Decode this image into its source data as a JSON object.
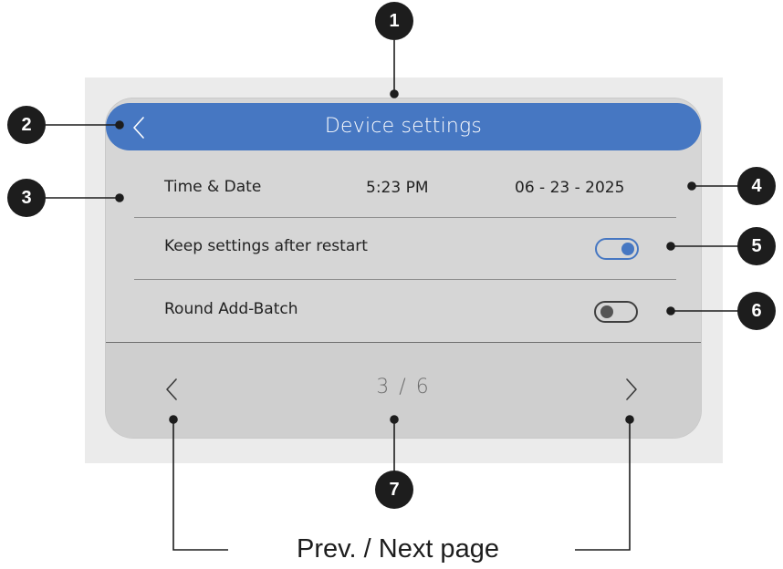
{
  "screen": {
    "title": "Device settings",
    "rows": {
      "time_date": {
        "label": "Time & Date",
        "time": "5:23 PM",
        "date": "06 - 23 - 2025"
      },
      "keep_settings": {
        "label": "Keep settings after restart",
        "enabled": true
      },
      "round_add_batch": {
        "label": "Round Add-Batch",
        "enabled": false
      }
    },
    "pagination": {
      "current": 3,
      "total": 6,
      "label": "3 / 6"
    }
  },
  "callouts": [
    "1",
    "2",
    "3",
    "4",
    "5",
    "6",
    "7"
  ],
  "caption": "Prev. / Next page",
  "colors": {
    "accent": "#4677c2",
    "panel": "#d6d6d6",
    "backdrop": "#ebebeb",
    "callout": "#1d1d1d"
  },
  "icons": {
    "back": "chevron-left-icon",
    "prev": "chevron-left-icon",
    "next": "chevron-right-icon"
  }
}
